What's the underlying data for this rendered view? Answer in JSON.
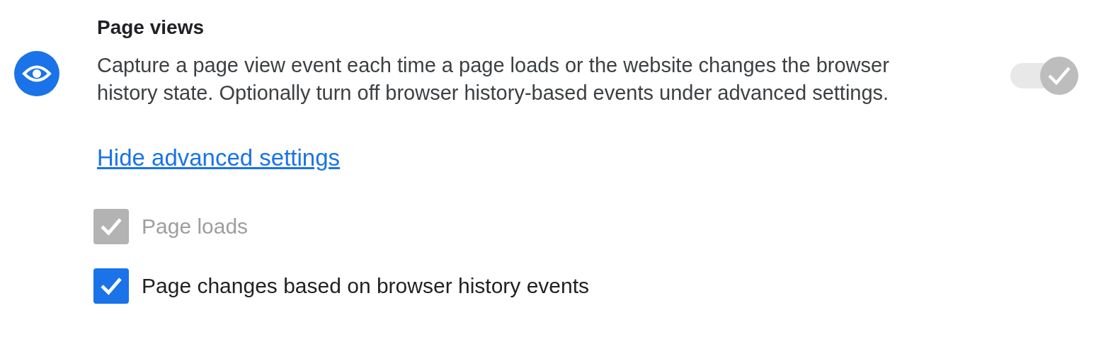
{
  "section": {
    "title": "Page views",
    "description": "Capture a page view event each time a page loads or the website changes the browser history state. Optionally turn off browser history-based events under advanced settings.",
    "toggle": {
      "on": true,
      "disabled": true
    }
  },
  "advanced_link": "Hide advanced settings",
  "options": [
    {
      "label": "Page loads",
      "checked": true,
      "disabled": true
    },
    {
      "label": "Page changes based on browser history events",
      "checked": true,
      "disabled": false
    }
  ]
}
